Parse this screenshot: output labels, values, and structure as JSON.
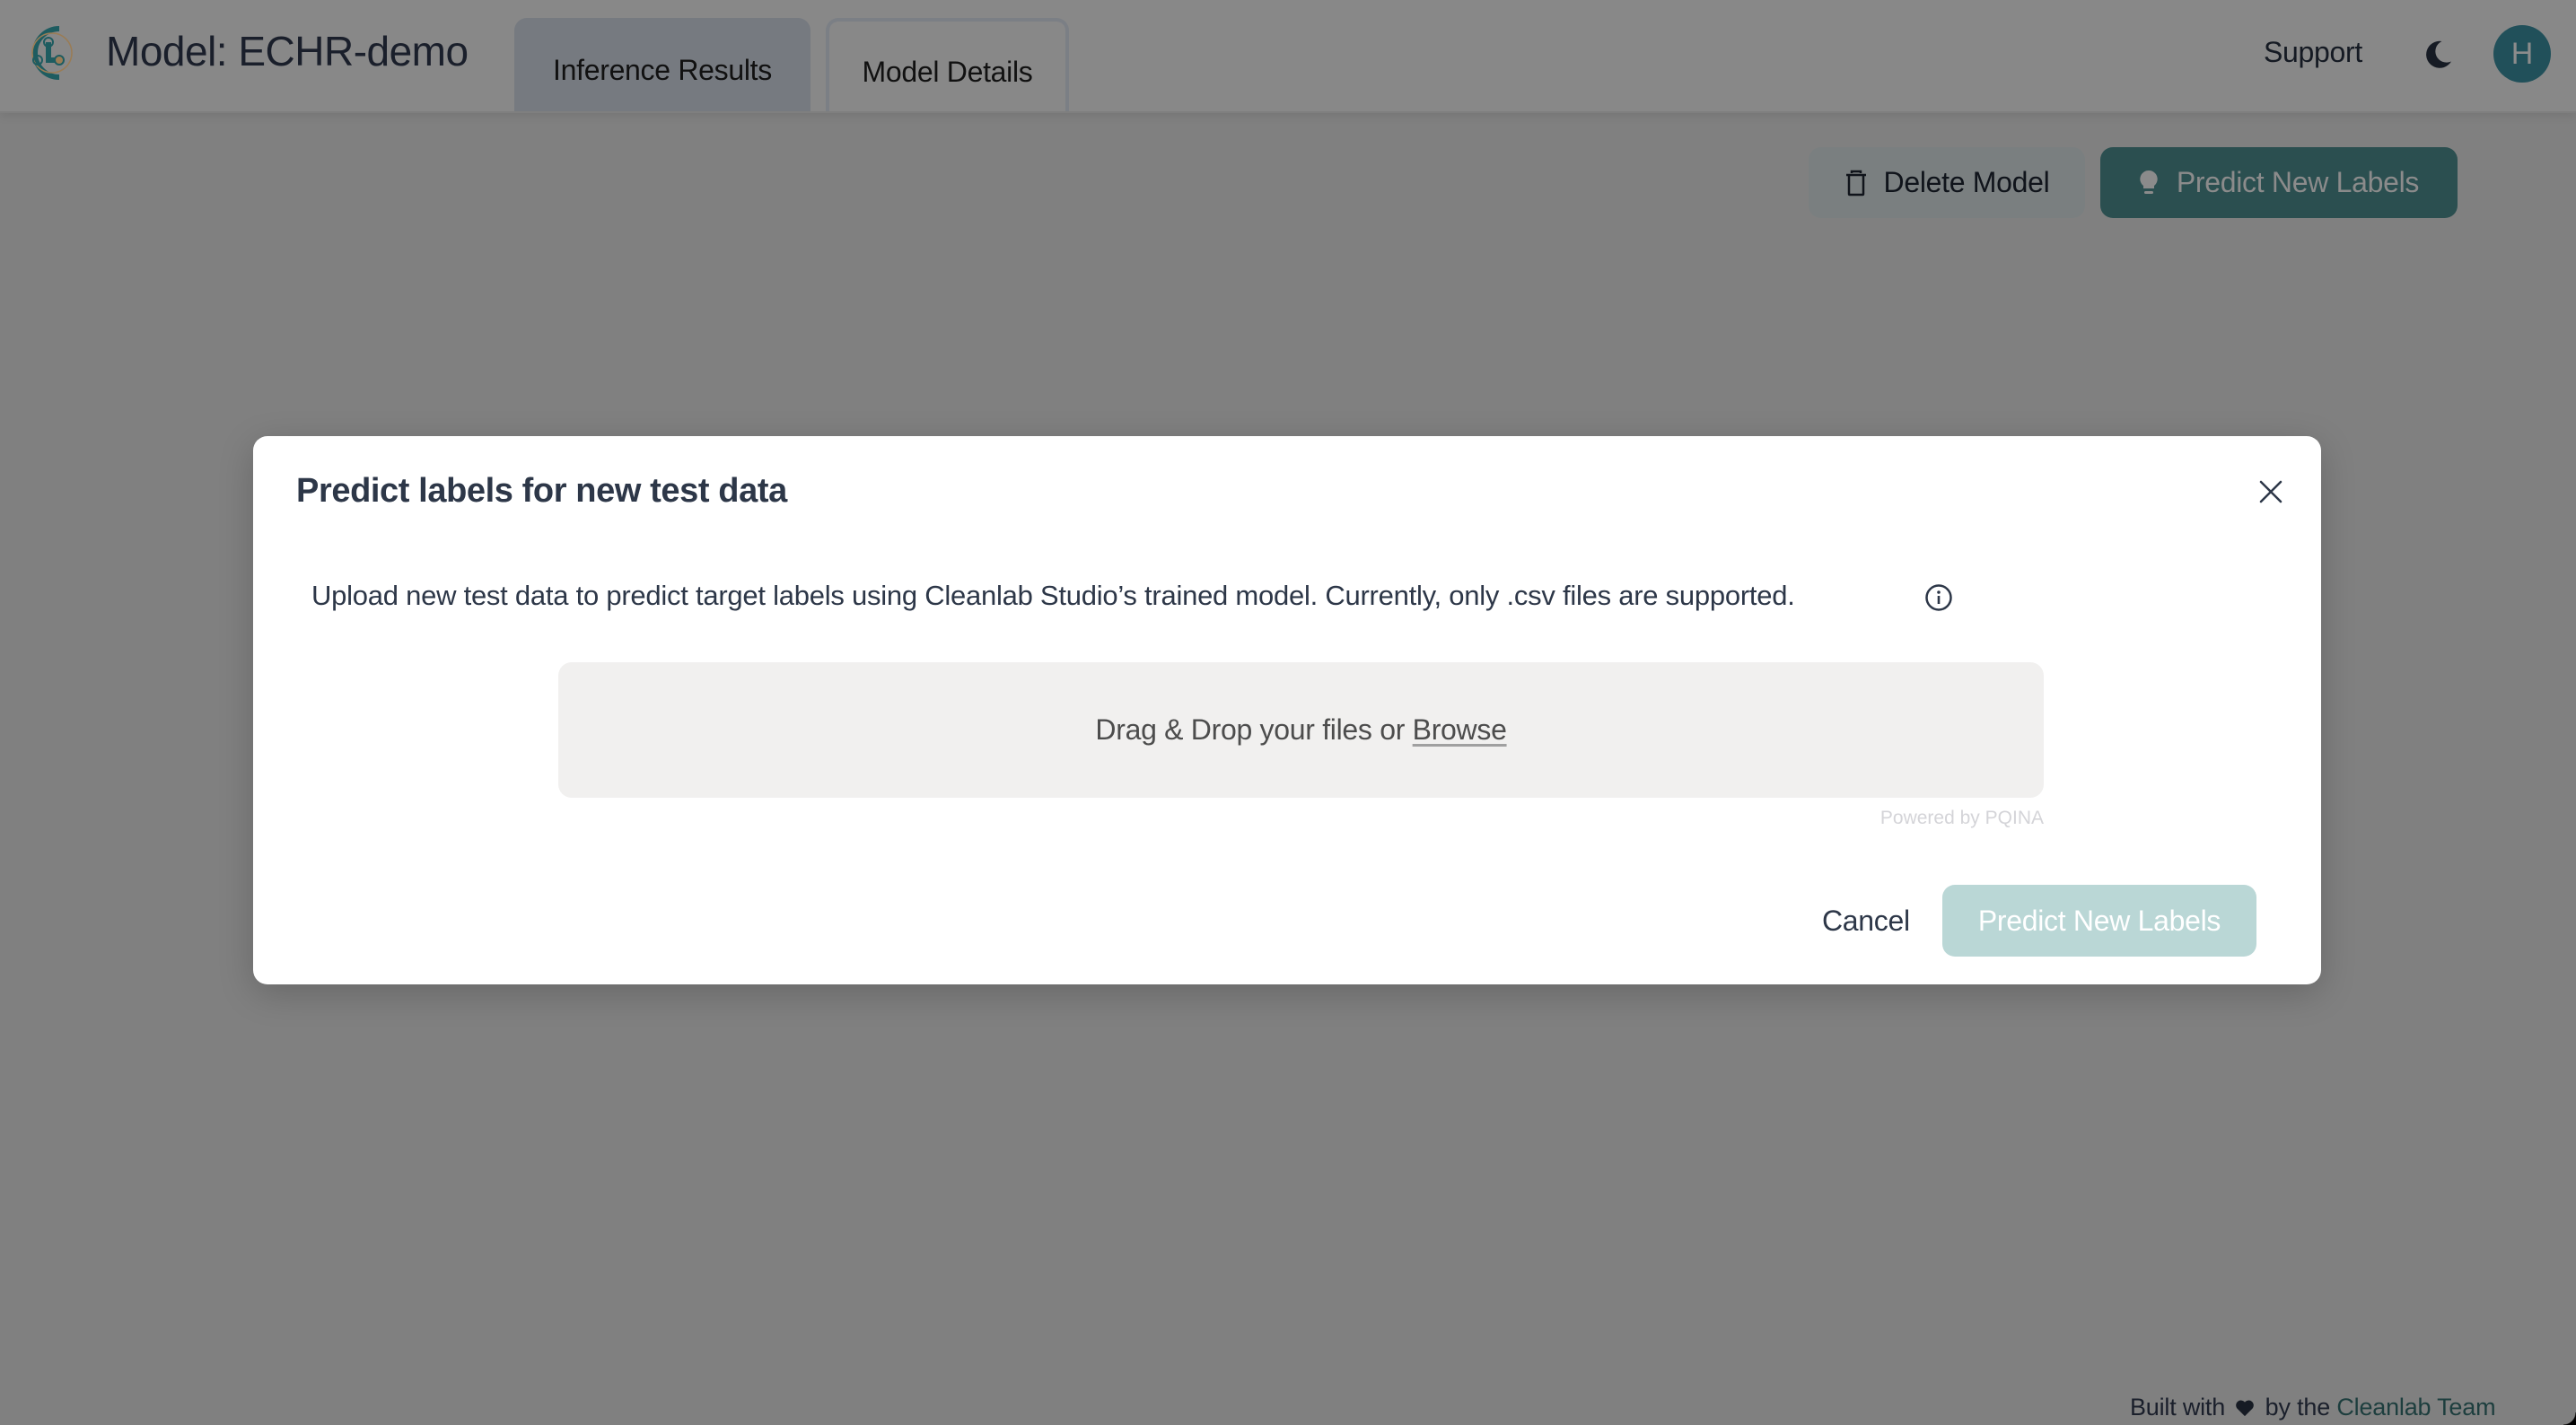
{
  "header": {
    "title": "Model: ECHR-demo",
    "tabs": [
      {
        "label": "Inference Results",
        "active": true
      },
      {
        "label": "Model Details",
        "active": false
      }
    ],
    "support_label": "Support",
    "theme_icon": "moon-icon",
    "avatar_initial": "H"
  },
  "toolbar": {
    "delete_label": "Delete Model",
    "predict_label": "Predict New Labels"
  },
  "modal": {
    "title": "Predict labels for new test data",
    "description": "Upload new test data to predict target labels using Cleanlab Studio’s trained model. Currently, only .csv files are supported.",
    "dropzone": {
      "text": "Drag & Drop your files or",
      "browse_label": "Browse",
      "powered_by": "Powered by PQINA"
    },
    "cancel_label": "Cancel",
    "submit_label": "Predict New Labels",
    "submit_disabled": true
  },
  "footer": {
    "prefix": "Built with",
    "middle": "by the",
    "link_label": "Cleanlab Team"
  },
  "colors": {
    "brand": "#2b4f50",
    "brand_disabled": "#bad7d6",
    "overlay_bg": "#808080"
  }
}
